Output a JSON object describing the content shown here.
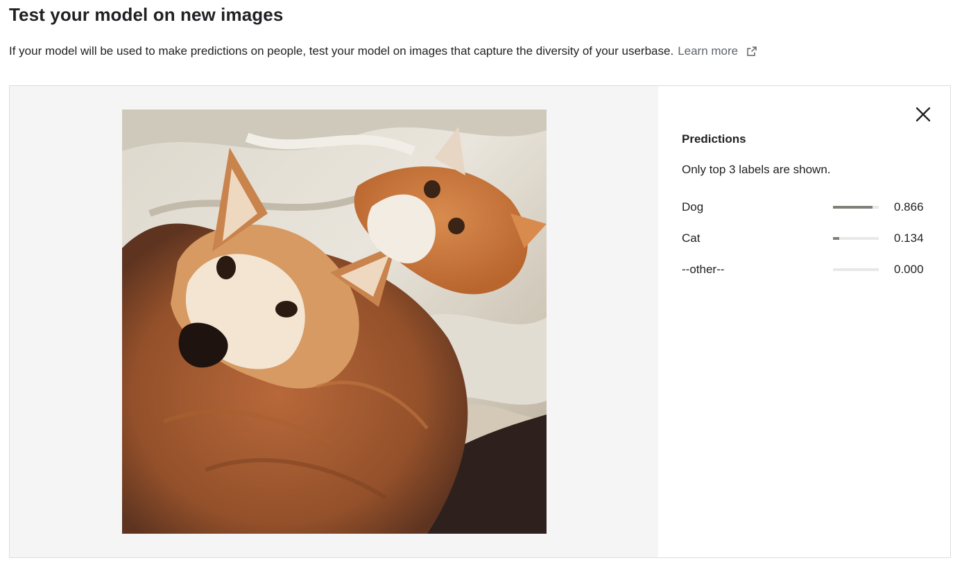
{
  "page": {
    "title": "Test your model on new images",
    "intro_text": "If your model will be used to make predictions on people, test your model on images that capture the diversity of your userbase.",
    "learn_more_label": "Learn more",
    "learn_more_icon": "open-in-new-icon"
  },
  "image_pane": {
    "background": "#f5f5f5"
  },
  "predictions": {
    "title": "Predictions",
    "note": "Only top 3 labels are shown.",
    "close_icon": "close-icon",
    "bar_color": "#7d8276",
    "items": [
      {
        "label": "Dog",
        "value": "0.866",
        "score": 0.866
      },
      {
        "label": "Cat",
        "value": "0.134",
        "score": 0.134
      },
      {
        "label": "--other--",
        "value": "0.000",
        "score": 0.0
      }
    ]
  }
}
